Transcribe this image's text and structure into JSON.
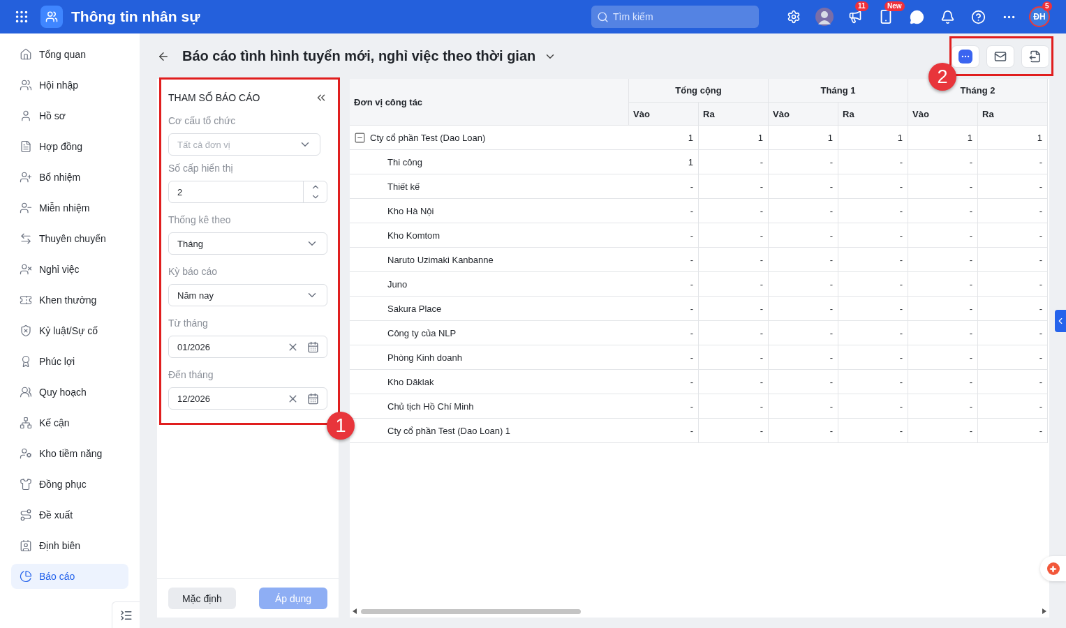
{
  "app": {
    "title": "Thông tin nhân sự"
  },
  "search": {
    "placeholder": "Tìm kiếm"
  },
  "topbar": {
    "announcement_badge": "11",
    "phone_badge": "New",
    "avatar_initials": "ĐH",
    "avatar_badge": "5"
  },
  "sidebar": {
    "items": [
      {
        "label": "Tổng quan",
        "selected": false
      },
      {
        "label": "Hội nhập",
        "selected": false
      },
      {
        "label": "Hồ sơ",
        "selected": false
      },
      {
        "label": "Hợp đồng",
        "selected": false
      },
      {
        "label": "Bổ nhiệm",
        "selected": false
      },
      {
        "label": "Miễn nhiệm",
        "selected": false
      },
      {
        "label": "Thuyên chuyển",
        "selected": false
      },
      {
        "label": "Nghỉ việc",
        "selected": false
      },
      {
        "label": "Khen thưởng",
        "selected": false
      },
      {
        "label": "Kỷ luật/Sự cố",
        "selected": false
      },
      {
        "label": "Phúc lợi",
        "selected": false
      },
      {
        "label": "Quy hoạch",
        "selected": false
      },
      {
        "label": "Kế cận",
        "selected": false
      },
      {
        "label": "Kho tiềm năng",
        "selected": false
      },
      {
        "label": "Đồng phục",
        "selected": false
      },
      {
        "label": "Đề xuất",
        "selected": false
      },
      {
        "label": "Định biên",
        "selected": false
      },
      {
        "label": "Báo cáo",
        "selected": true
      }
    ]
  },
  "page": {
    "title": "Báo cáo tình hình tuyển mới, nghỉ việc theo thời gian"
  },
  "params": {
    "title": "THAM SỐ BÁO CÁO",
    "fields": [
      {
        "kind": "select",
        "label": "Cơ cấu tổ chức",
        "placeholder": "Tất cả đơn vị"
      },
      {
        "kind": "number",
        "label": "Số cấp hiển thị",
        "value": "2"
      },
      {
        "kind": "select",
        "label": "Thống kê theo",
        "value": "Tháng"
      },
      {
        "kind": "select",
        "label": "Kỳ báo cáo",
        "value": "Năm nay"
      },
      {
        "kind": "date",
        "label": "Từ tháng",
        "value": "01/2026"
      },
      {
        "kind": "date",
        "label": "Đến tháng",
        "value": "12/2026"
      }
    ],
    "buttons": [
      {
        "label": "Mặc định",
        "kind": "secondary"
      },
      {
        "label": "Áp dụng",
        "kind": "primary",
        "disabled": true
      }
    ]
  },
  "table": {
    "first_column": "Đơn vị công tác",
    "groups": [
      {
        "label": "Tổng cộng",
        "columns": [
          "Vào",
          "Ra"
        ]
      },
      {
        "label": "Tháng 1",
        "columns": [
          "Vào",
          "Ra"
        ]
      },
      {
        "label": "Tháng 2",
        "columns": [
          "Vào",
          "Ra"
        ]
      }
    ],
    "rows": [
      {
        "name": "Cty cổ phần Test (Dao Loan)",
        "expanded": true,
        "values": [
          "1",
          "1",
          "1",
          "1",
          "1",
          "1"
        ],
        "children": [
          {
            "name": "Thi công",
            "values": [
              "1",
              "-",
              "-",
              "-",
              "-",
              "-"
            ]
          },
          {
            "name": "Thiết kế",
            "values": [
              "-",
              "-",
              "-",
              "-",
              "-",
              "-"
            ]
          },
          {
            "name": "Kho Hà Nội",
            "values": [
              "-",
              "-",
              "-",
              "-",
              "-",
              "-"
            ]
          },
          {
            "name": "Kho Komtom",
            "values": [
              "-",
              "-",
              "-",
              "-",
              "-",
              "-"
            ]
          },
          {
            "name": "Naruto Uzimaki Kanbanne",
            "values": [
              "-",
              "-",
              "-",
              "-",
              "-",
              "-"
            ]
          },
          {
            "name": "Juno",
            "values": [
              "-",
              "-",
              "-",
              "-",
              "-",
              "-"
            ]
          },
          {
            "name": "Sakura Place",
            "values": [
              "-",
              "-",
              "-",
              "-",
              "-",
              "-"
            ]
          },
          {
            "name": "Công ty của NLP",
            "values": [
              "-",
              "-",
              "-",
              "-",
              "-",
              "-"
            ]
          },
          {
            "name": "Phòng Kinh doanh",
            "values": [
              "-",
              "-",
              "-",
              "-",
              "-",
              "-"
            ]
          },
          {
            "name": "Kho Dăklak",
            "values": [
              "-",
              "-",
              "-",
              "-",
              "-",
              "-"
            ]
          },
          {
            "name": "Chủ tịch Hồ Chí Minh",
            "values": [
              "-",
              "-",
              "-",
              "-",
              "-",
              "-"
            ]
          },
          {
            "name": "Cty cổ phần Test (Dao Loan) 1",
            "values": [
              "-",
              "-",
              "-",
              "-",
              "-",
              "-"
            ]
          }
        ]
      }
    ]
  },
  "annotations": [
    {
      "label": "1"
    },
    {
      "label": "2"
    }
  ]
}
